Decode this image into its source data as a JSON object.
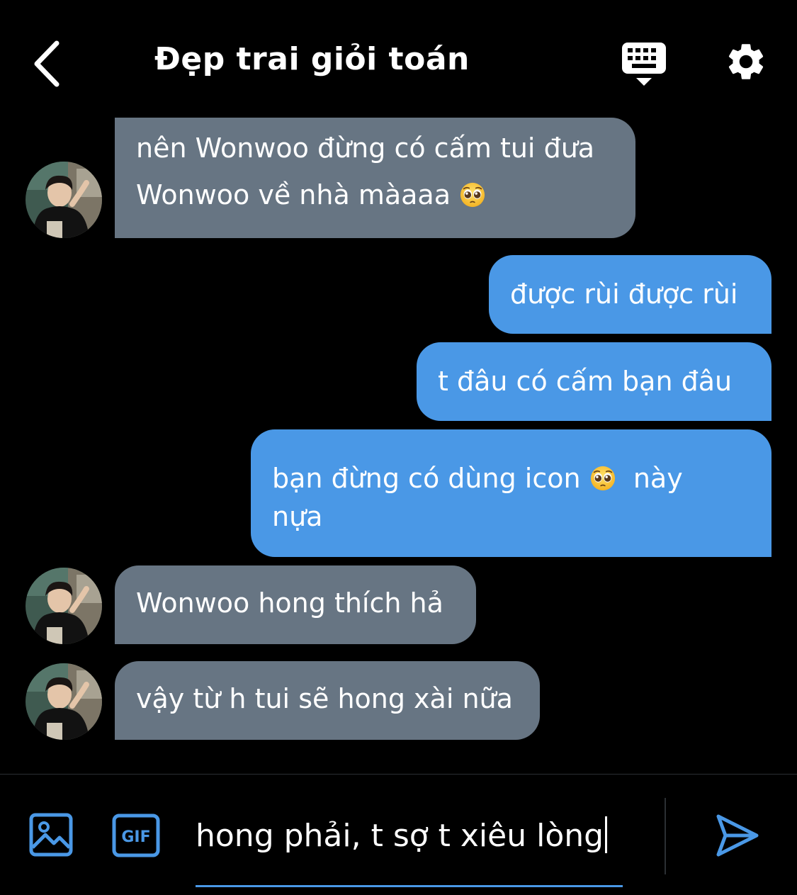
{
  "header": {
    "title": "Đẹp trai giỏi toán",
    "back_icon": "chevron-left-icon",
    "keyboard_icon": "keyboard-icon",
    "settings_icon": "gear-icon"
  },
  "messages": [
    {
      "direction": "incoming",
      "lines": [
        "nên Wonwoo đừng có cấm tui đưa",
        "Wonwoo về nhà màaaa"
      ],
      "emoji": "pleading-face-emoji"
    },
    {
      "direction": "outgoing",
      "lines": [
        "được rùi được rùi"
      ]
    },
    {
      "direction": "outgoing",
      "lines": [
        "t đâu có cấm bạn đâu"
      ]
    },
    {
      "direction": "outgoing",
      "lines": [
        "bạn đừng có dùng icon",
        "này",
        "nựa"
      ],
      "emoji": "pleading-face-emoji"
    },
    {
      "direction": "incoming",
      "lines": [
        "Wonwoo hong thích hả"
      ]
    },
    {
      "direction": "incoming",
      "lines": [
        "vậy từ h tui sẽ hong xài nữa"
      ]
    }
  ],
  "composer": {
    "input_value": "hong phải, t sợ t xiêu lòng",
    "gif_label": "GIF",
    "media_icon": "image-icon",
    "send_icon": "send-icon"
  },
  "colors": {
    "background": "#000000",
    "incoming_bubble": "#677583",
    "outgoing_bubble": "#4a98e6",
    "accent": "#4a98e6"
  }
}
